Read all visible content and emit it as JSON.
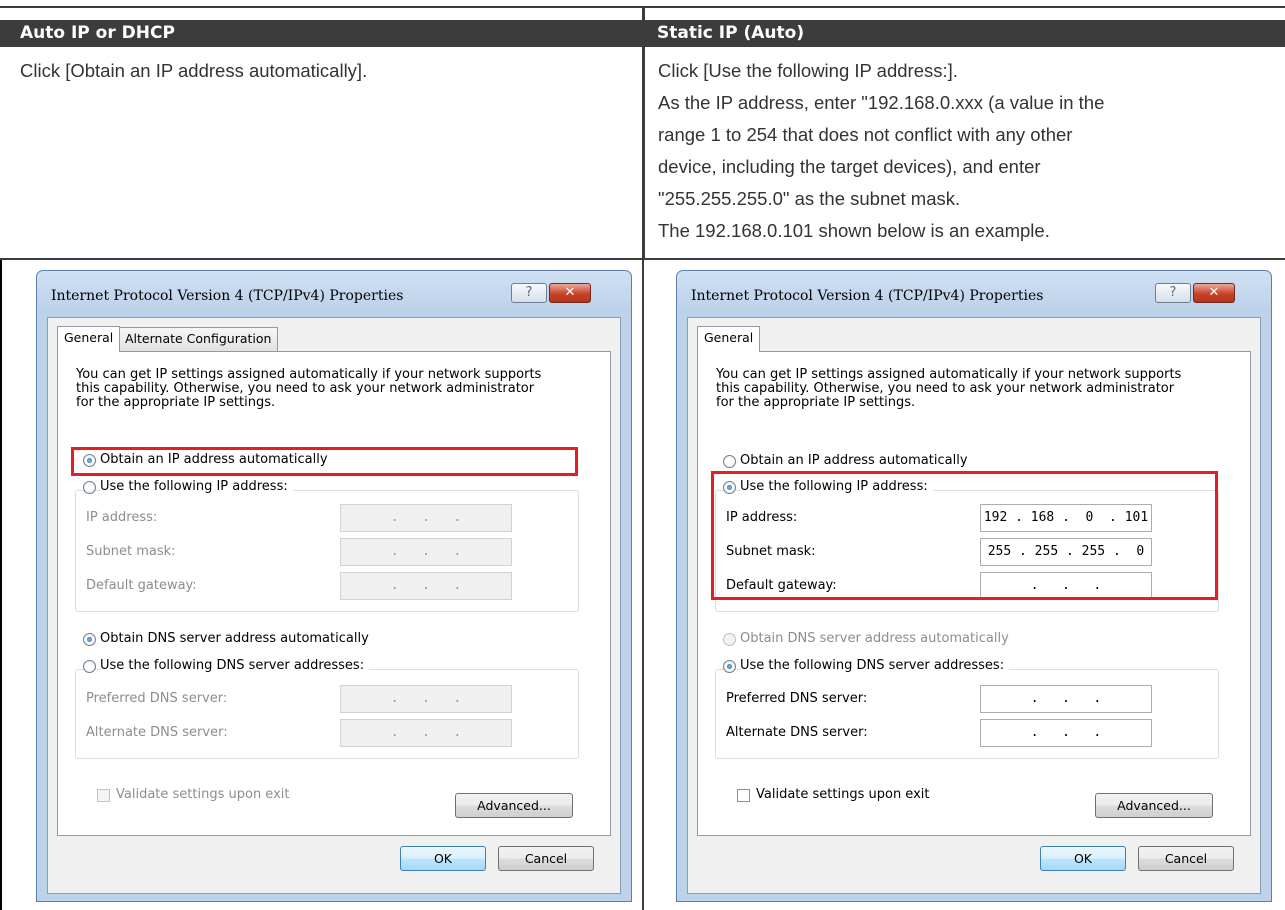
{
  "table": {
    "left_header": "Auto IP or DHCP",
    "right_header": "Static IP (Auto)",
    "left_text": [
      "Click [Obtain an IP address automatically]."
    ],
    "right_text": [
      "Click [Use the following IP address:].",
      "As the IP address, enter \"192.168.0.xxx (a value in the",
      "range 1 to 254 that does not conflict with any other",
      "device, including the target devices), and enter",
      "\"255.255.255.0\" as the subnet mask.",
      "The 192.168.0.101 shown below is an example."
    ]
  },
  "dialogs": [
    {
      "title": "Internet Protocol Version 4 (TCP/IPv4) Properties",
      "help_label": "?",
      "close_label": "✕",
      "tabs": [
        "General",
        "Alternate Configuration"
      ],
      "description": [
        "You can get IP settings assigned automatically if your network supports",
        "this capability. Otherwise, you need to ask your network administrator",
        "for the appropriate IP settings."
      ],
      "obtain_ip_label": "Obtain an IP address automatically",
      "use_ip_label": "Use the following IP address:",
      "ip_address_label": "IP address:",
      "ip_address_value": ".   .   .",
      "subnet_mask_label": "Subnet mask:",
      "subnet_mask_value": ".   .   .",
      "gateway_label": "Default gateway:",
      "gateway_value": ".   .   .",
      "obtain_dns_label": "Obtain DNS server address automatically",
      "use_dns_label": "Use the following DNS server addresses:",
      "preferred_dns_label": "Preferred DNS server:",
      "preferred_dns_value": ".   .   .",
      "alternate_dns_label": "Alternate DNS server:",
      "alternate_dns_value": ".   .   .",
      "validate_label": "Validate settings upon exit",
      "advanced_label": "Advanced...",
      "ok_label": "OK",
      "cancel_label": "Cancel",
      "selected_ip_option": "obtain",
      "selected_dns_option": "obtain"
    },
    {
      "title": "Internet Protocol Version 4 (TCP/IPv4) Properties",
      "help_label": "?",
      "close_label": "✕",
      "tabs": [
        "General"
      ],
      "description": [
        "You can get IP settings assigned automatically if your network supports",
        "this capability. Otherwise, you need to ask your network administrator",
        "for the appropriate IP settings."
      ],
      "obtain_ip_label": "Obtain an IP address automatically",
      "use_ip_label": "Use the following IP address:",
      "ip_address_label": "IP address:",
      "ip_address_value": "192 . 168 .  0  . 101",
      "subnet_mask_label": "Subnet mask:",
      "subnet_mask_value": "255 . 255 . 255 .  0",
      "gateway_label": "Default gateway:",
      "gateway_value": ".   .   .",
      "obtain_dns_label": "Obtain DNS server address automatically",
      "use_dns_label": "Use the following DNS server addresses:",
      "preferred_dns_label": "Preferred DNS server:",
      "preferred_dns_value": ".   .   .",
      "alternate_dns_label": "Alternate DNS server:",
      "alternate_dns_value": ".   .   .",
      "validate_label": "Validate settings upon exit",
      "advanced_label": "Advanced...",
      "ok_label": "OK",
      "cancel_label": "Cancel",
      "selected_ip_option": "use",
      "selected_dns_option": "use"
    }
  ],
  "colors": {
    "header_bg": "#3c3c3c",
    "highlight": "#e31e24"
  }
}
